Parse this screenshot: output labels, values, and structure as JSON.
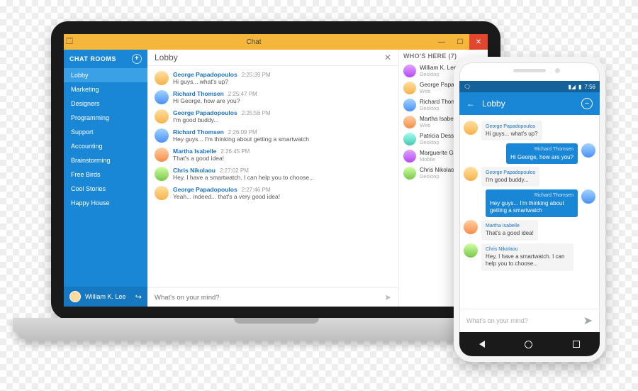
{
  "desktop": {
    "window": {
      "title": "Chat",
      "minimize": "—",
      "maximize": "☐",
      "close": "✕"
    },
    "sidebar": {
      "heading": "CHAT ROOMS",
      "add_label": "+",
      "items": [
        {
          "label": "Lobby",
          "active": true
        },
        {
          "label": "Marketing"
        },
        {
          "label": "Designers"
        },
        {
          "label": "Programming"
        },
        {
          "label": "Support"
        },
        {
          "label": "Accounting"
        },
        {
          "label": "Brainstorming"
        },
        {
          "label": "Free Birds"
        },
        {
          "label": "Cool Stories"
        },
        {
          "label": "Happy House"
        }
      ],
      "footer": {
        "user": "William K. Lee",
        "logout": "↪"
      }
    },
    "room": {
      "title": "Lobby",
      "close": "✕",
      "messages": [
        {
          "author": "George Papadopoulos",
          "time": "2:25:39 PM",
          "text": "Hi guys... what's up?",
          "av": "m1"
        },
        {
          "author": "Richard Thomsen",
          "time": "2:25:47 PM",
          "text": "Hi George, how are you?",
          "av": "m2"
        },
        {
          "author": "George Papadopoulos",
          "time": "2:25:56 PM",
          "text": "I'm good buddy...",
          "av": "m1"
        },
        {
          "author": "Richard Thomsen",
          "time": "2:26:09 PM",
          "text": "Hey guys... I'm thinking about getting a smartwatch",
          "av": "m2"
        },
        {
          "author": "Martha Isabelle",
          "time": "2:26:45 PM",
          "text": "That's a good idea!",
          "av": "m3"
        },
        {
          "author": "Chris Nikolaou",
          "time": "2:27:02 PM",
          "text": "Hey, I have a smartwatch. I can help you to choose...",
          "av": "m4"
        },
        {
          "author": "George Papadopoulos",
          "time": "2:27:46 PM",
          "text": "Yeah... indeed... that's a very good idea!",
          "av": "m1"
        }
      ],
      "compose_placeholder": "What's on your mind?"
    },
    "presence": {
      "heading": "WHO'S HERE (7)",
      "people": [
        {
          "name": "William K. Lee",
          "device": "Desktop",
          "av": "m5"
        },
        {
          "name": "George Papa…",
          "device": "Web",
          "av": "m1"
        },
        {
          "name": "Richard Thom…",
          "device": "Desktop",
          "av": "m2"
        },
        {
          "name": "Martha Isabe…",
          "device": "Web",
          "av": "m3"
        },
        {
          "name": "Patricia Dess…",
          "device": "Desktop",
          "av": "m6"
        },
        {
          "name": "Marguerite G…",
          "device": "Mobile",
          "av": "m5"
        },
        {
          "name": "Chris Nikolao…",
          "device": "Desktop",
          "av": "m4"
        }
      ]
    }
  },
  "mobile": {
    "status": {
      "left": "🗨",
      "signal": "▮◢",
      "batt": "▮",
      "time": "7:56"
    },
    "appbar": {
      "back": "←",
      "title": "Lobby",
      "menu": "−"
    },
    "messages": [
      {
        "author": "George Papadopoulos",
        "text": "Hi guys... what's up?",
        "mine": false,
        "av": "m1"
      },
      {
        "author": "Richard Thomsen",
        "text": "Hi George, how are you?",
        "mine": true,
        "av": "m2"
      },
      {
        "author": "George Papadopoulos",
        "text": "I'm good buddy...",
        "mine": false,
        "av": "m1"
      },
      {
        "author": "Richard Thomsen",
        "text": "Hey guys... I'm thinking about getting a smartwatch",
        "mine": true,
        "av": "m2"
      },
      {
        "author": "Martha Isabelle",
        "text": "That's a good idea!",
        "mine": false,
        "av": "m3"
      },
      {
        "author": "Chris Nikolaou",
        "text": "Hey, I have a smartwatch. I can help you to choose...",
        "mine": false,
        "av": "m4"
      }
    ],
    "compose_placeholder": "What's on your mind?",
    "send_icon": "➤"
  }
}
